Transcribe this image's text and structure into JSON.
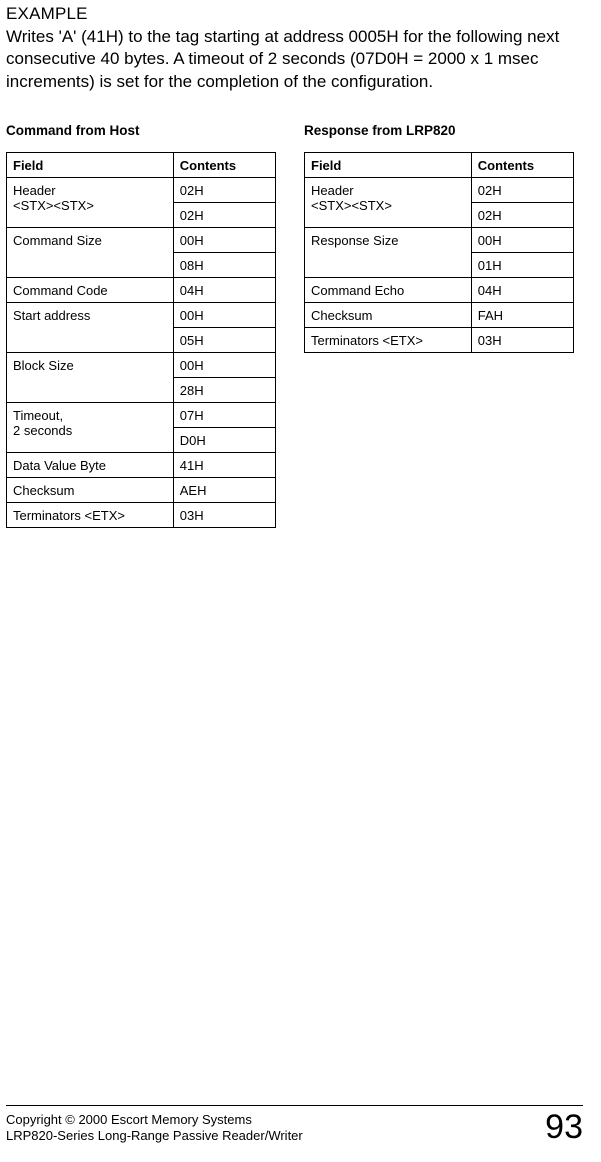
{
  "example": {
    "heading": "EXAMPLE",
    "body": "Writes 'A' (41H) to the tag starting at address 0005H for the following next consecutive 40 bytes. A timeout of 2 seconds (07D0H = 2000 x 1 msec increments) is set for the completion of the configuration."
  },
  "left": {
    "title": "Command from Host",
    "headers": {
      "field": "Field",
      "contents": "Contents"
    },
    "rows": [
      {
        "field": "Header\n<STX><STX>",
        "contents": "02H",
        "rowspan": 2
      },
      {
        "contents": "02H"
      },
      {
        "field": "Command Size",
        "contents": "00H",
        "rowspan": 2
      },
      {
        "contents": "08H"
      },
      {
        "field": "Command Code",
        "contents": "04H"
      },
      {
        "field": "Start address",
        "contents": "00H",
        "rowspan": 2
      },
      {
        "contents": "05H"
      },
      {
        "field": "Block Size",
        "contents": "00H",
        "rowspan": 2
      },
      {
        "contents": "28H"
      },
      {
        "field": "Timeout,\n2 seconds",
        "contents": "07H",
        "rowspan": 2
      },
      {
        "contents": "D0H"
      },
      {
        "field": "Data Value Byte",
        "contents": "41H"
      },
      {
        "field": "Checksum",
        "contents": "AEH"
      },
      {
        "field": "Terminators <ETX>",
        "contents": "03H"
      }
    ]
  },
  "right": {
    "title": "Response from LRP820",
    "headers": {
      "field": "Field",
      "contents": "Contents"
    },
    "rows": [
      {
        "field": "Header\n<STX><STX>",
        "contents": "02H",
        "rowspan": 2
      },
      {
        "contents": "02H"
      },
      {
        "field": "Response Size",
        "contents": "00H",
        "rowspan": 2
      },
      {
        "contents": "01H"
      },
      {
        "field": "Command Echo",
        "contents": "04H"
      },
      {
        "field": "Checksum",
        "contents": "FAH"
      },
      {
        "field": "Terminators <ETX>",
        "contents": "03H"
      }
    ]
  },
  "footer": {
    "line1": "Copyright © 2000 Escort Memory Systems",
    "line2": "LRP820-Series Long-Range Passive Reader/Writer",
    "page": "93"
  }
}
